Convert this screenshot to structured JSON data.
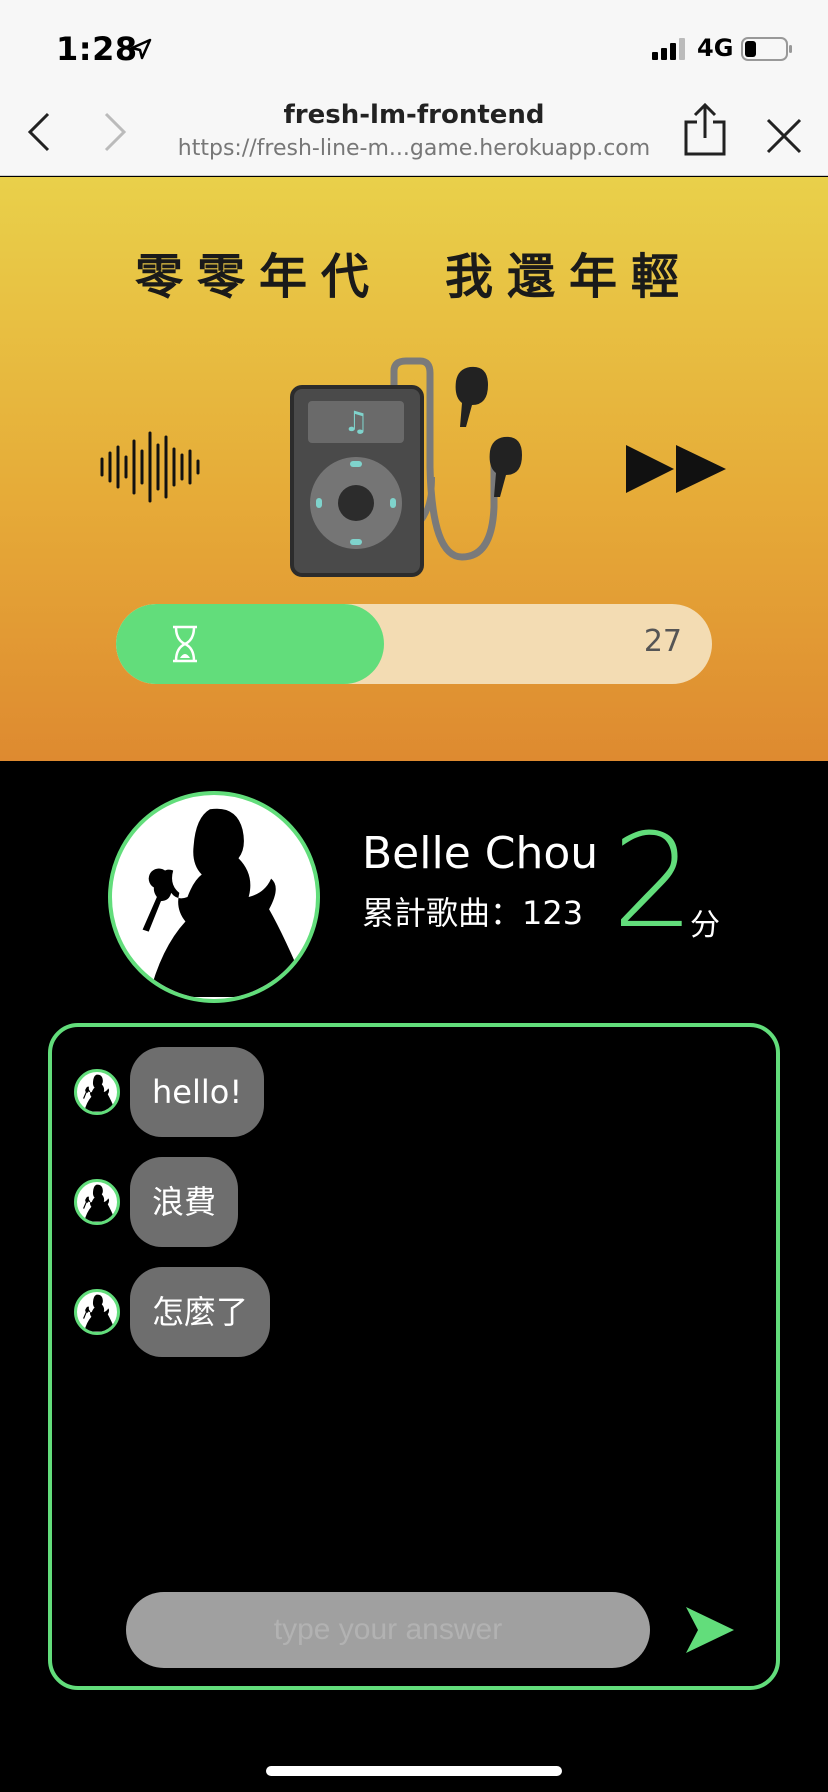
{
  "status_bar": {
    "time": "1:28",
    "network": "4G",
    "icons": [
      "location-arrow-icon",
      "signal-icon",
      "battery-icon"
    ]
  },
  "browser": {
    "title": "fresh-lm-frontend",
    "url": "https://fresh-line-m...game.herokuapp.com",
    "icons": [
      "back-chevron-icon",
      "forward-chevron-icon",
      "share-icon",
      "close-icon"
    ]
  },
  "game": {
    "title": "零零年代　我還年輕",
    "timer_value": "27",
    "timer_progress": 0.45,
    "icons": [
      "sound-wave-icon",
      "music-player-icon",
      "fast-forward-icon",
      "hourglass-icon"
    ]
  },
  "profile": {
    "name": "Belle Chou",
    "song_count": "累計歌曲：123",
    "score": "2",
    "score_unit": "分"
  },
  "chat": {
    "messages": [
      {
        "text": "hello!"
      },
      {
        "text": "浪費"
      },
      {
        "text": "怎麼了"
      }
    ],
    "input_placeholder": "type your answer",
    "icons": [
      "send-icon"
    ]
  },
  "colors": {
    "accent": "#62dd7b",
    "gradient_top": "#e9d04a",
    "gradient_bottom": "#de8a30",
    "bubble": "#6e6e6e",
    "timer_track": "#f3dcb3"
  }
}
